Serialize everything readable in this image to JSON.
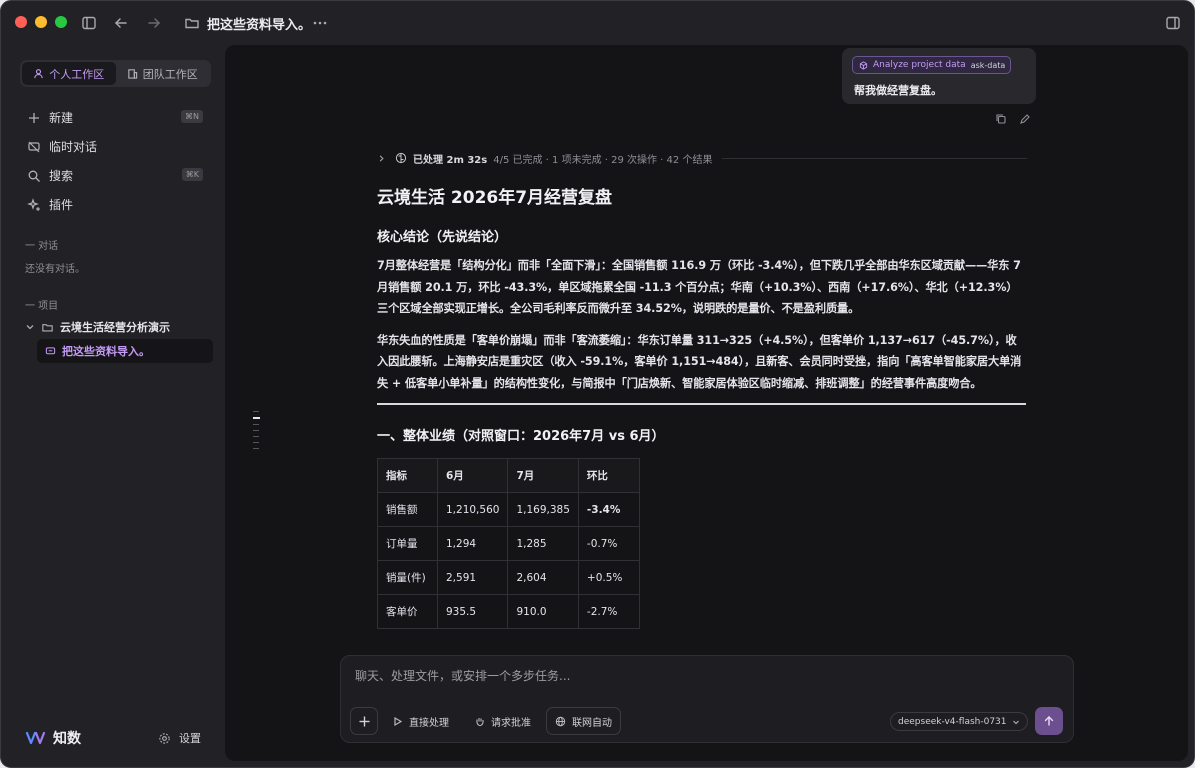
{
  "window": {
    "title": "把这些资料导入。"
  },
  "sidebar": {
    "workspace_tabs": [
      {
        "label": "个人工作区",
        "active": true
      },
      {
        "label": "团队工作区",
        "active": false
      }
    ],
    "nav": [
      {
        "label": "新建",
        "icon": "plus-icon",
        "shortcut": "⌘N"
      },
      {
        "label": "临时对话",
        "icon": "temporary-chat-icon",
        "shortcut": ""
      },
      {
        "label": "搜索",
        "icon": "search-icon",
        "shortcut": "⌘K"
      },
      {
        "label": "插件",
        "icon": "sparkle-icon",
        "shortcut": ""
      }
    ],
    "conversations_heading": "一 对话",
    "conversations_empty": "还没有对话。",
    "projects_heading": "一 项目",
    "project": {
      "name": "云境生活经营分析演示"
    },
    "active_conversation": "把这些资料导入。",
    "brand": "知数",
    "settings_label": "设置"
  },
  "thread": {
    "user_message": {
      "skill_label": "Analyze project data",
      "skill_tag": "ask-data",
      "text": "帮我做经营复盘。"
    },
    "status": {
      "label": "已处理 2m 32s",
      "details": "4/5 已完成 · 1 项未完成 · 29 次操作 · 42 个结果"
    },
    "report": {
      "title": "云境生活 2026年7月经营复盘",
      "conclusion_heading": "核心结论（先说结论）",
      "paragraph1": "7月整体经营是「结构分化」而非「全面下滑」：全国销售额 116.9 万（环比 -3.4%），但下跌几乎全部由华东区域贡献——华东 7 月销售额 20.1 万，环比 -43.3%，单区域拖累全国 -11.3 个百分点；华南（+10.3%）、西南（+17.6%）、华北（+12.3%）三个区域全部实现正增长。全公司毛利率反而微升至 34.52%，说明跌的是量价、不是盈利质量。",
      "paragraph2": "华东失血的性质是「客单价崩塌」而非「客流萎缩」：华东订单量 311→325（+4.5%），但客单价 1,137→617（-45.7%），收入因此腰斩。上海静安店是重灾区（收入 -59.1%，客单价 1,151→484），且新客、会员同时受挫，指向「高客单智能家居大单消失 + 低客单小单补量」的结构性变化，与简报中「门店焕新、智能家居体验区临时缩减、排班调整」的经营事件高度吻合。",
      "section1_heading": "一、整体业绩（对照窗口：2026年7月 vs 6月）",
      "table": {
        "headers": [
          "指标",
          "6月",
          "7月",
          "环比"
        ],
        "rows": [
          {
            "metric": "销售额",
            "jun": "1,210,560",
            "jul": "1,169,385",
            "mom": "-3.4%",
            "highlight": true
          },
          {
            "metric": "订单量",
            "jun": "1,294",
            "jul": "1,285",
            "mom": "-0.7%",
            "highlight": false
          },
          {
            "metric": "销量(件)",
            "jun": "2,591",
            "jul": "2,604",
            "mom": "+0.5%",
            "highlight": false
          },
          {
            "metric": "客单价",
            "jun": "935.5",
            "jul": "910.0",
            "mom": "-2.7%",
            "highlight": false
          }
        ]
      }
    }
  },
  "composer": {
    "placeholder": "聊天、处理文件，或安排一个多步任务...",
    "value": "",
    "buttons": {
      "direct": "直接处理",
      "approval": "请求批准",
      "web": "联网自动"
    },
    "model": "deepseek-v4-flash-0731"
  },
  "colors": {
    "accent": "#c49bf5",
    "send_button": "#6b4f8e",
    "main_bg": "#141417",
    "sidebar_bg": "#222226"
  }
}
